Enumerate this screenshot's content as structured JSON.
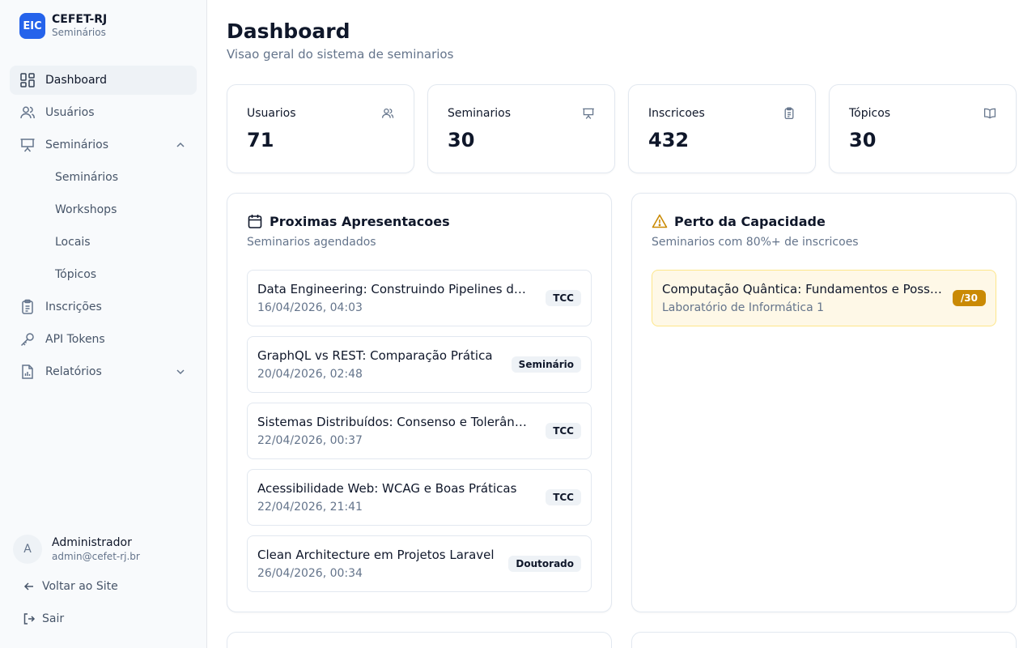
{
  "brand": {
    "logo": "EIC",
    "name": "CEFET-RJ",
    "subtitle": "Seminários"
  },
  "sidebar": {
    "items": [
      {
        "label": "Dashboard",
        "icon": "dashboard-icon",
        "active": true
      },
      {
        "label": "Usuários",
        "icon": "users-icon"
      },
      {
        "label": "Seminários",
        "icon": "presentation-icon",
        "expanded": true
      },
      {
        "label": "Inscrições",
        "icon": "clipboard-icon"
      },
      {
        "label": "API Tokens",
        "icon": "key-icon"
      },
      {
        "label": "Relatórios",
        "icon": "report-icon",
        "expanded": false
      }
    ],
    "subitems": [
      "Seminários",
      "Workshops",
      "Locais",
      "Tópicos"
    ]
  },
  "user": {
    "initial": "A",
    "name": "Administrador",
    "email": "admin@cefet-rj.br"
  },
  "footer": {
    "back_label": "Voltar ao Site",
    "logout_label": "Sair"
  },
  "page": {
    "title": "Dashboard",
    "subtitle": "Visao geral do sistema de seminarios"
  },
  "stats": [
    {
      "label": "Usuarios",
      "value": "71",
      "icon": "users-icon"
    },
    {
      "label": "Seminarios",
      "value": "30",
      "icon": "presentation-icon"
    },
    {
      "label": "Inscricoes",
      "value": "432",
      "icon": "clipboard-icon"
    },
    {
      "label": "Tópicos",
      "value": "30",
      "icon": "book-icon"
    }
  ],
  "upcoming": {
    "title": "Proximas Apresentacoes",
    "subtitle": "Seminarios agendados",
    "items": [
      {
        "title": "Data Engineering: Construindo Pipelines de Dados",
        "date": "16/04/2026, 04:03",
        "badge": "TCC"
      },
      {
        "title": "GraphQL vs REST: Comparação Prática",
        "date": "20/04/2026, 02:48",
        "badge": "Seminário"
      },
      {
        "title": "Sistemas Distribuídos: Consenso e Tolerância a Falhas",
        "date": "22/04/2026, 00:37",
        "badge": "TCC"
      },
      {
        "title": "Acessibilidade Web: WCAG e Boas Práticas",
        "date": "22/04/2026, 21:41",
        "badge": "TCC"
      },
      {
        "title": "Clean Architecture em Projetos Laravel",
        "date": "26/04/2026, 00:34",
        "badge": "Doutorado"
      }
    ]
  },
  "capacity": {
    "title": "Perto da Capacidade",
    "subtitle": "Seminarios com 80%+ de inscricoes",
    "items": [
      {
        "title": "Computação Quântica: Fundamentos e Possibilidades",
        "location": "Laboratório de Informática 1",
        "badge": "/30"
      }
    ]
  },
  "colors": {
    "accent": "#2563eb",
    "warning": "#ca8a04"
  }
}
